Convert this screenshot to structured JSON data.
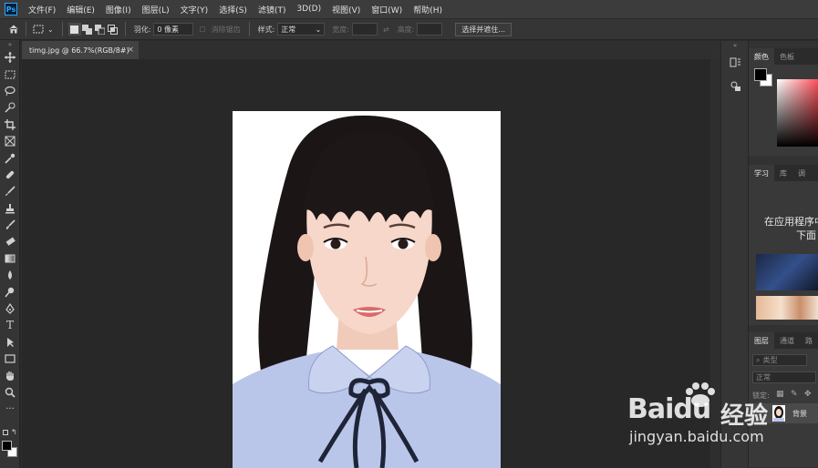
{
  "app": {
    "logo": "Ps"
  },
  "menu": [
    "文件(F)",
    "编辑(E)",
    "图像(I)",
    "图层(L)",
    "文字(Y)",
    "选择(S)",
    "滤镜(T)",
    "3D(D)",
    "视图(V)",
    "窗口(W)",
    "帮助(H)"
  ],
  "options": {
    "feather_label": "羽化:",
    "feather_value": "0 像素",
    "antialias_label": "消除锯齿",
    "style_label": "样式:",
    "style_value": "正常",
    "width_label": "宽度:",
    "height_label": "高度:",
    "select_mask_button": "选择并遮住..."
  },
  "document": {
    "tab_title": "timg.jpg @ 66.7%(RGB/8#)",
    "close": "×"
  },
  "color_panel": {
    "tabs": [
      "颜色",
      "色板"
    ],
    "fg": "#000000",
    "bg": "#ffffff"
  },
  "learn_panel": {
    "tabs": [
      "学习",
      "库",
      "调"
    ],
    "text_line1": "在应用程序中",
    "text_line2": "下面"
  },
  "layers_panel": {
    "tabs": [
      "图层",
      "通道",
      "路"
    ],
    "filter_placeholder": "类型",
    "blend_mode": "正常",
    "lock_label": "锁定:",
    "layer_name": "背景"
  },
  "watermark": {
    "brand": "Baidu",
    "cn": "经验",
    "url": "jingyan.baidu.com"
  }
}
